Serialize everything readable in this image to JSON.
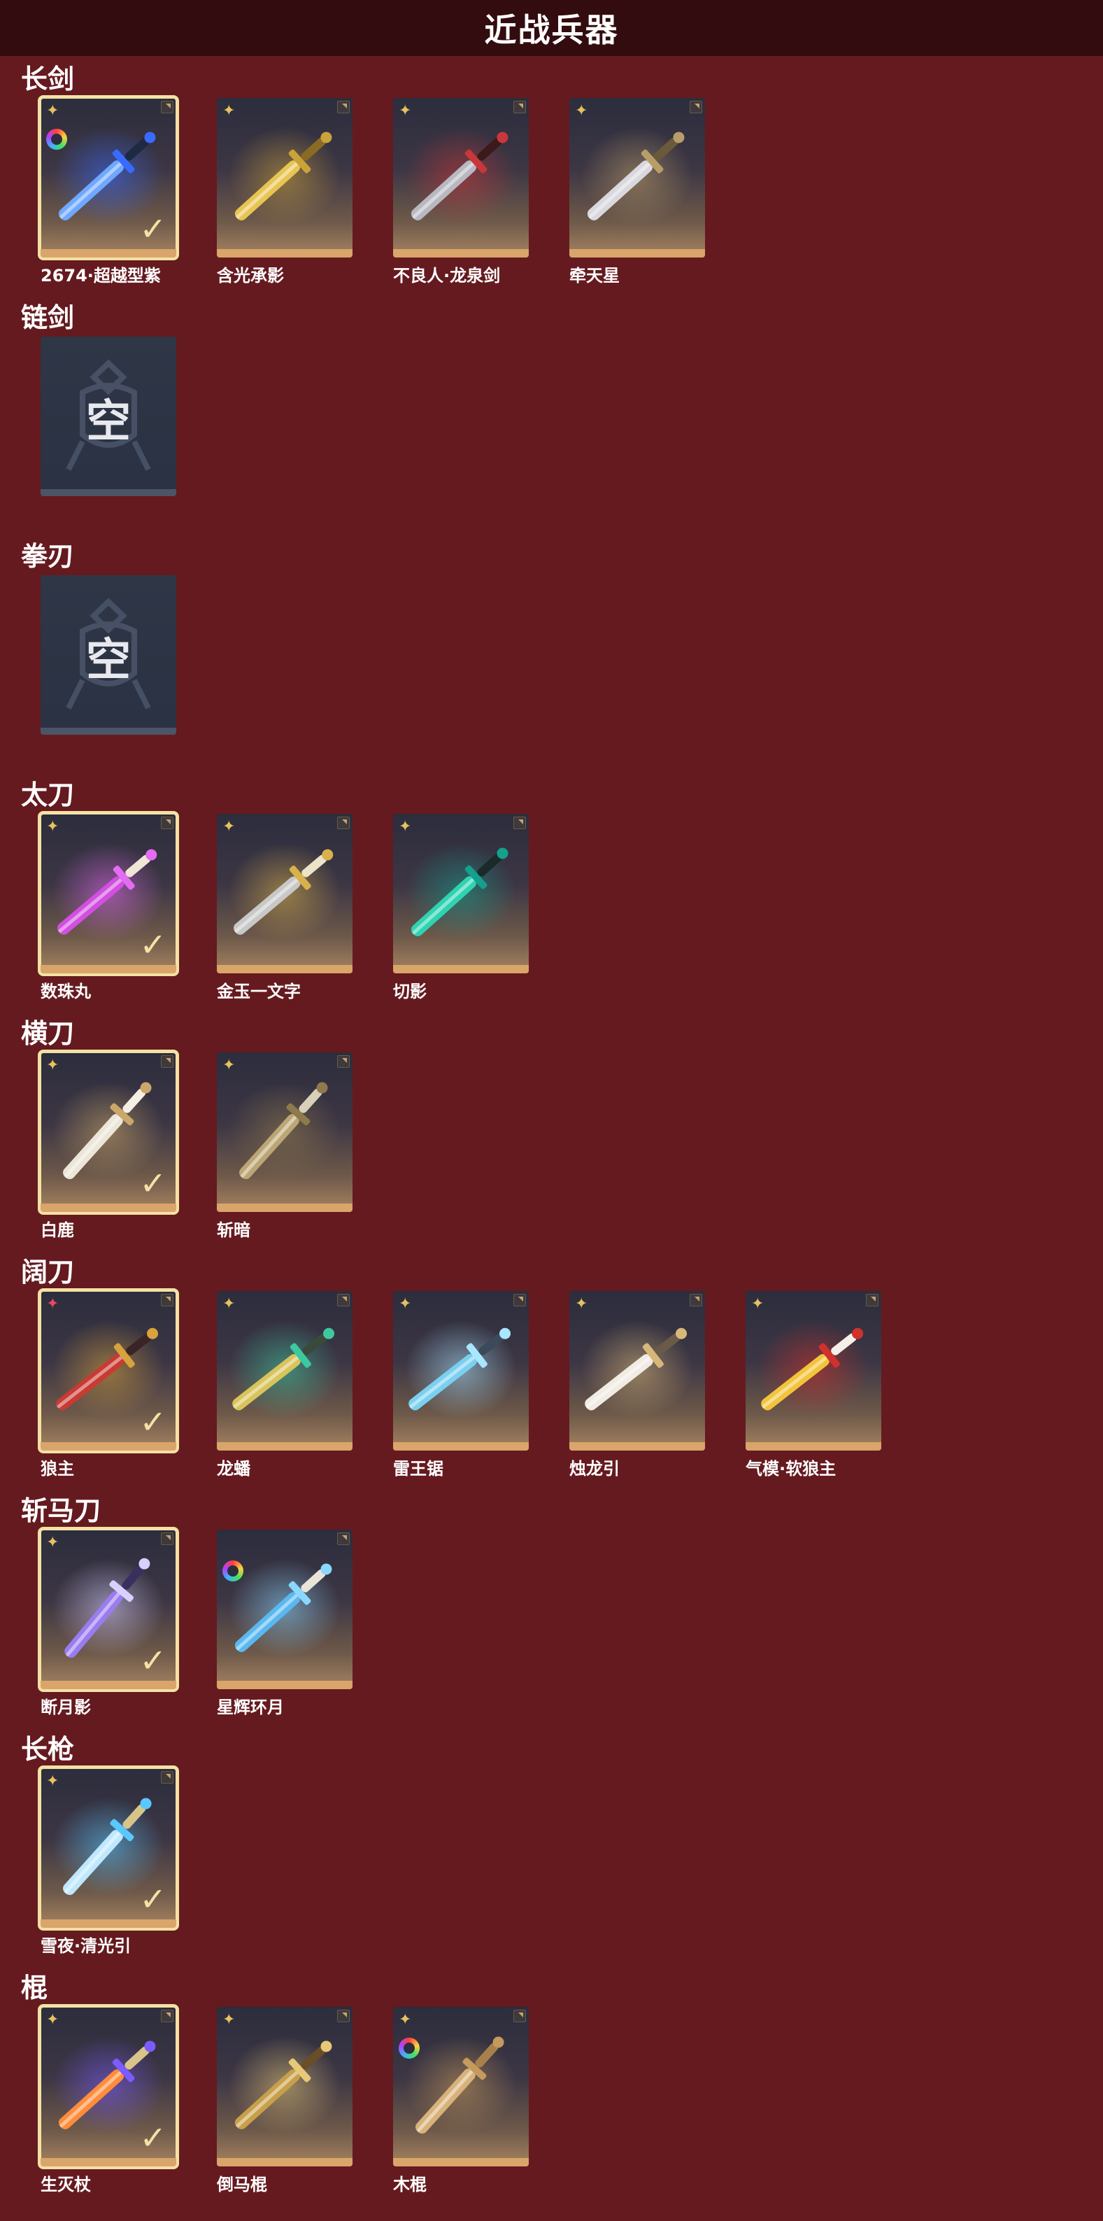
{
  "header": {
    "title": "近战兵器"
  },
  "categories": [
    {
      "title": "长剑",
      "items": [
        {
          "name": "2674·超越型紫",
          "selected": true,
          "quality": "star",
          "ring": true,
          "weapon": "blue-blade"
        },
        {
          "name": "含光承影",
          "selected": false,
          "quality": "star",
          "ring": false,
          "weapon": "gold-sword"
        },
        {
          "name": "不良人·龙泉剑",
          "selected": false,
          "quality": "star",
          "ring": false,
          "weapon": "red-sword"
        },
        {
          "name": "牵天星",
          "selected": false,
          "quality": "star",
          "ring": false,
          "weapon": "silver-sword"
        }
      ]
    },
    {
      "title": "链剑",
      "items": [
        {
          "empty": true,
          "empty_label": "空"
        }
      ]
    },
    {
      "title": "拳刃",
      "items": [
        {
          "empty": true,
          "empty_label": "空"
        }
      ]
    },
    {
      "title": "太刀",
      "items": [
        {
          "name": "数珠丸",
          "selected": true,
          "quality": "star",
          "ring": false,
          "weapon": "purple-katana"
        },
        {
          "name": "金玉一文字",
          "selected": false,
          "quality": "star",
          "ring": false,
          "weapon": "gold-katana"
        },
        {
          "name": "切影",
          "selected": false,
          "quality": "star",
          "ring": false,
          "weapon": "teal-katana"
        }
      ]
    },
    {
      "title": "横刀",
      "items": [
        {
          "name": "白鹿",
          "selected": true,
          "quality": "star",
          "ring": false,
          "weapon": "white-saber"
        },
        {
          "name": "斩暗",
          "selected": false,
          "quality": "star",
          "ring": false,
          "weapon": "bronze-saber"
        }
      ]
    },
    {
      "title": "阔刀",
      "items": [
        {
          "name": "狼主",
          "selected": true,
          "quality": "red-star",
          "ring": false,
          "weapon": "red-broadblade"
        },
        {
          "name": "龙蟠",
          "selected": false,
          "quality": "star",
          "ring": false,
          "weapon": "jade-broadblade"
        },
        {
          "name": "雷王锯",
          "selected": false,
          "quality": "star",
          "ring": false,
          "weapon": "ice-broadblade"
        },
        {
          "name": "烛龙引",
          "selected": false,
          "quality": "star",
          "ring": false,
          "weapon": "white-broadblade"
        },
        {
          "name": "气模·软狼主",
          "selected": false,
          "quality": "star",
          "ring": false,
          "weapon": "yellow-broadblade"
        }
      ]
    },
    {
      "title": "斩马刀",
      "items": [
        {
          "name": "断月影",
          "selected": true,
          "quality": "star",
          "ring": false,
          "weapon": "violet-glaive"
        },
        {
          "name": "星辉环月",
          "selected": false,
          "quality": "none",
          "ring": true,
          "weapon": "star-glaive"
        }
      ]
    },
    {
      "title": "长枪",
      "items": [
        {
          "name": "雪夜·清光引",
          "selected": true,
          "quality": "star",
          "ring": false,
          "weapon": "ice-spear"
        }
      ]
    },
    {
      "title": "棍",
      "items": [
        {
          "name": "生灭杖",
          "selected": true,
          "quality": "star",
          "ring": false,
          "weapon": "flame-staff"
        },
        {
          "name": "倒马棍",
          "selected": false,
          "quality": "star",
          "ring": false,
          "weapon": "gold-staff"
        },
        {
          "name": "木棍",
          "selected": false,
          "quality": "star",
          "ring": true,
          "weapon": "wood-staff"
        }
      ]
    }
  ],
  "colors": {
    "background": "#651a1f",
    "header": "#330c0f",
    "card_rim": "#d9a56b",
    "selected_border": "#f4e1a4",
    "quality_gold": "#e6c15f",
    "quality_red": "#e54a5f"
  },
  "icons": {
    "quality": "four-point-star-icon",
    "selected": "checkmark-icon",
    "corner": "corner-tag-icon",
    "ring": "rainbow-ring-icon"
  }
}
